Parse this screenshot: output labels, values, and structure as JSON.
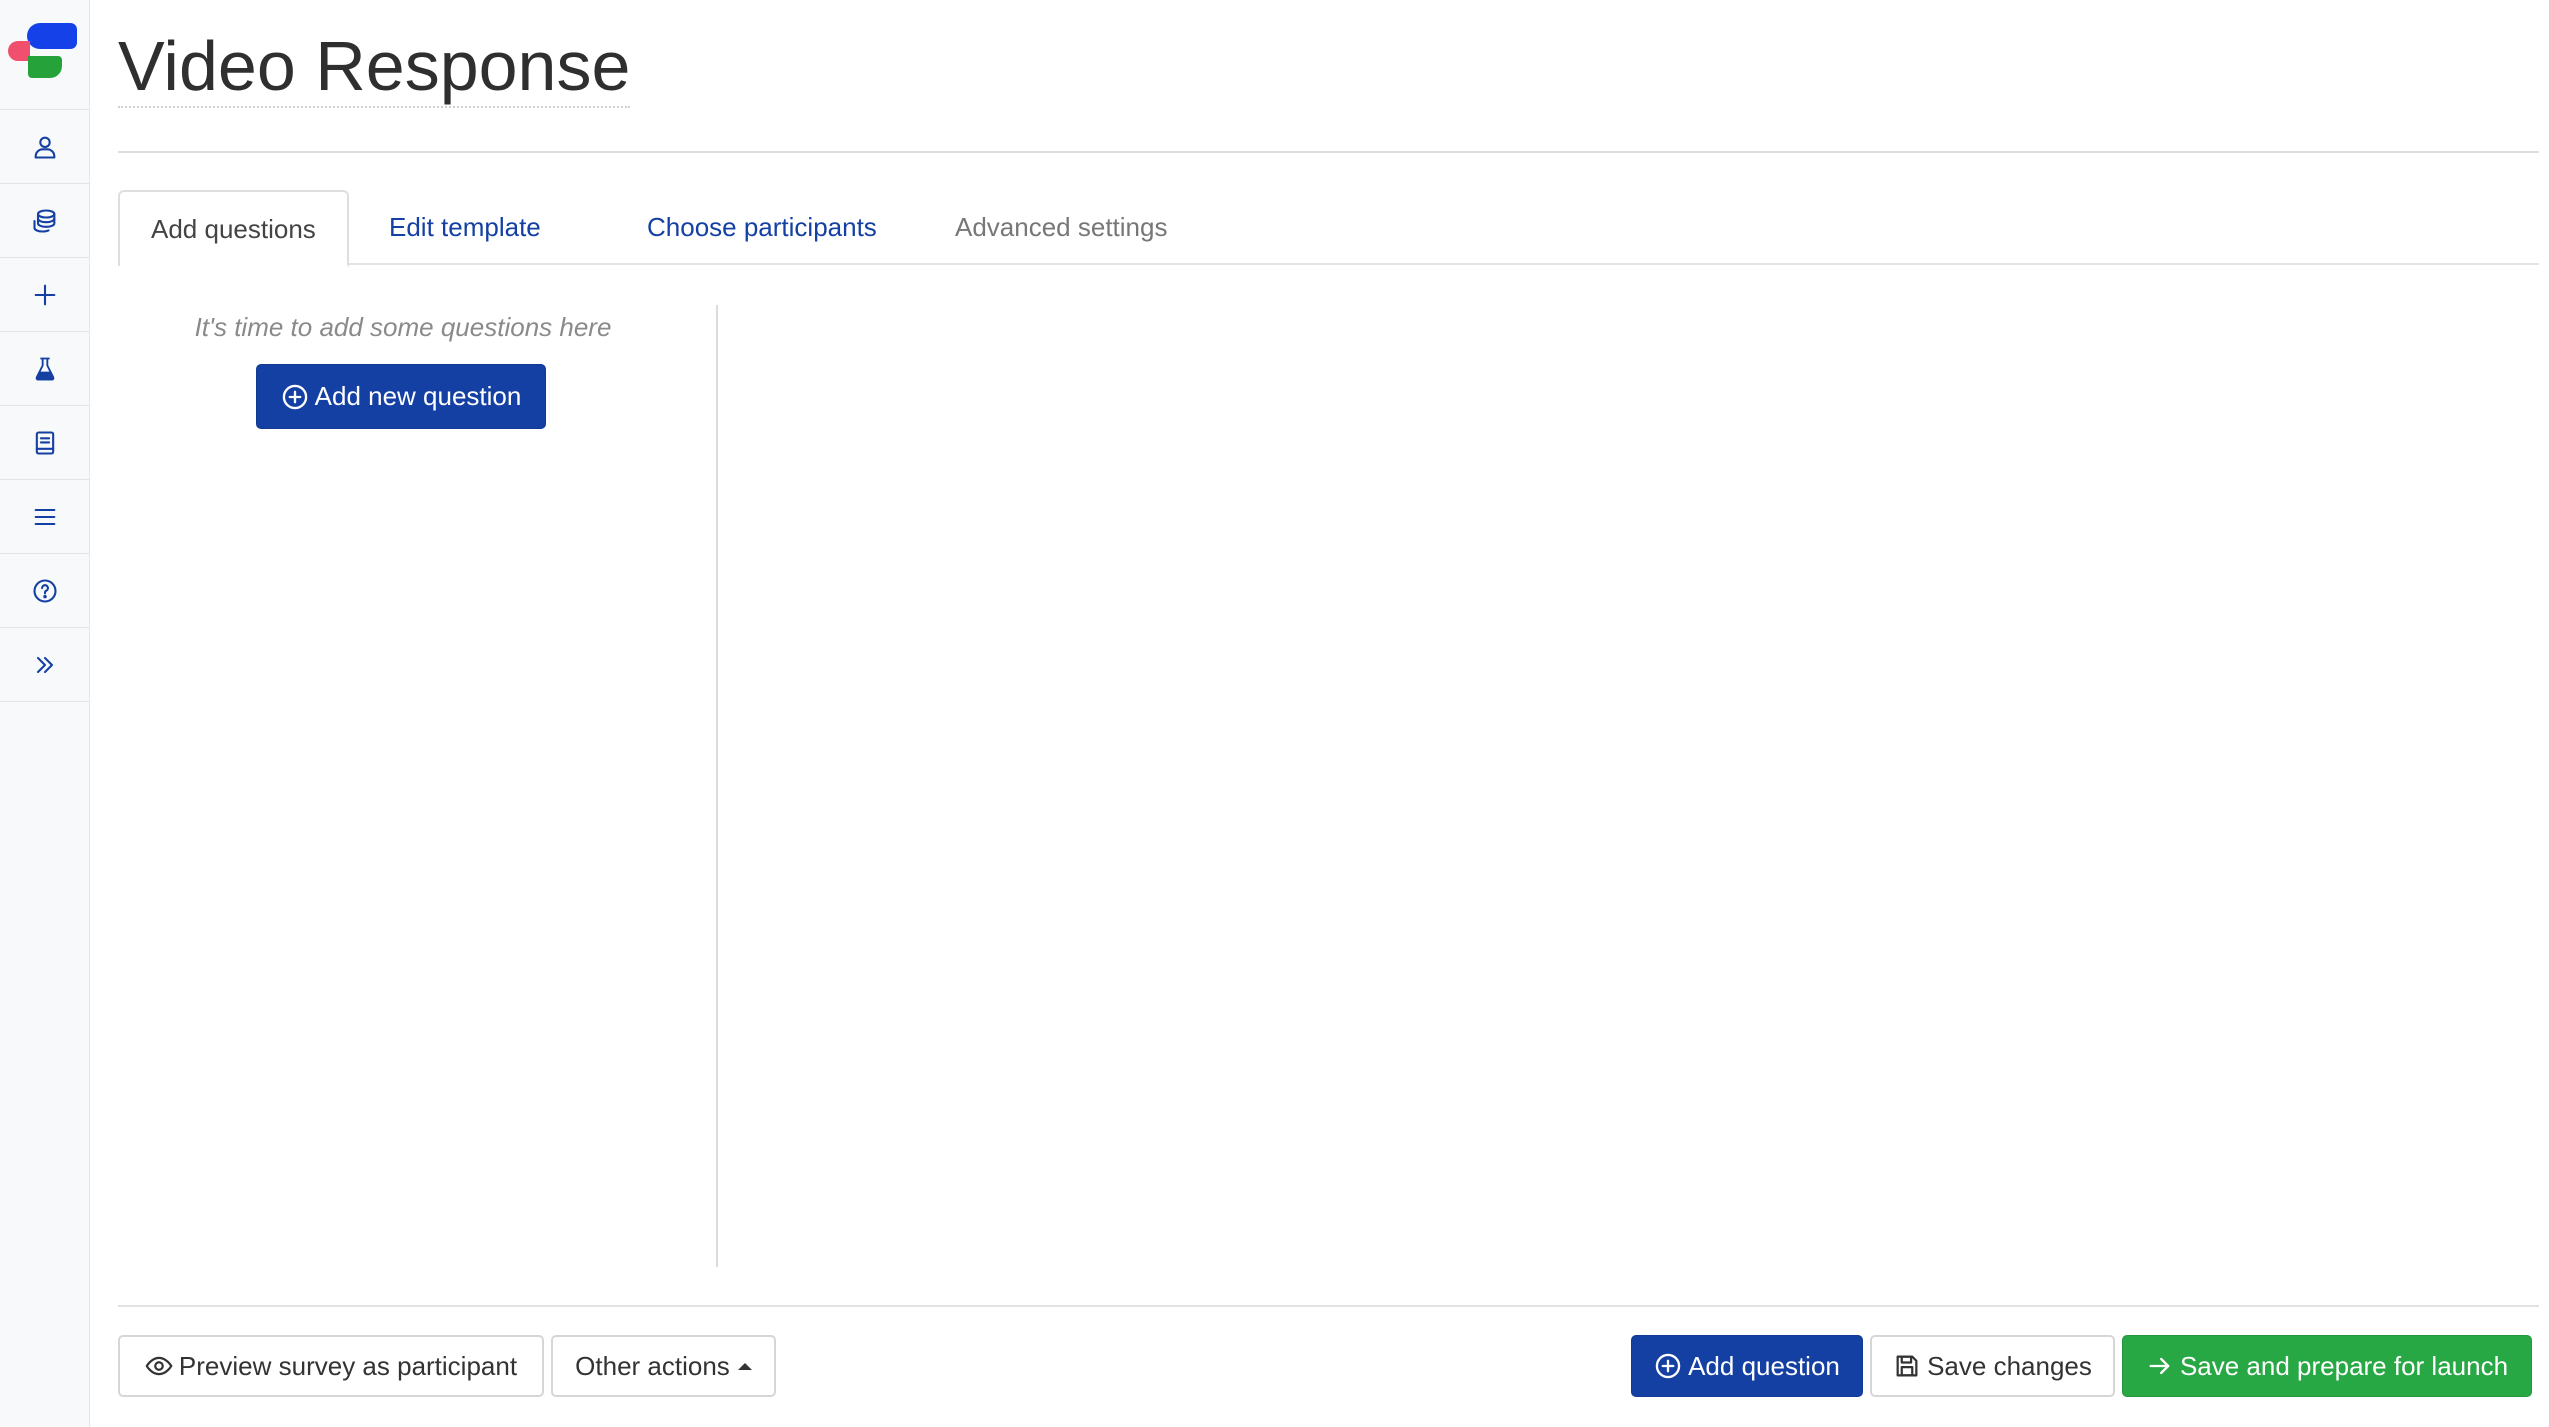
{
  "page": {
    "title": "Video Response"
  },
  "sidebar": {
    "logo": "app-logo",
    "items": [
      {
        "icon": "user-icon",
        "label": ""
      },
      {
        "icon": "database-icon",
        "label": ""
      },
      {
        "icon": "plus-icon",
        "label": ""
      },
      {
        "icon": "flask-icon",
        "label": ""
      },
      {
        "icon": "book-icon",
        "label": ""
      },
      {
        "icon": "menu-icon",
        "label": ""
      },
      {
        "icon": "help-icon",
        "label": ""
      },
      {
        "icon": "chevrons-right-icon",
        "label": ""
      }
    ]
  },
  "tabs": [
    {
      "label": "Add questions",
      "state": "active"
    },
    {
      "label": "Edit template",
      "state": "link"
    },
    {
      "label": "Choose participants",
      "state": "link"
    },
    {
      "label": "Advanced settings",
      "state": "muted"
    }
  ],
  "questions_panel": {
    "empty_hint": "It's time to add some questions here",
    "add_new_label": "Add new question"
  },
  "footer": {
    "preview_label": "Preview survey as participant",
    "other_actions_label": "Other actions",
    "add_question_label": "Add question",
    "save_label": "Save changes",
    "save_launch_label": "Save and prepare for launch"
  },
  "colors": {
    "primary": "#1540a3",
    "success": "#28a745",
    "logo_blue": "#1542e8",
    "logo_red": "#f0506e",
    "logo_green": "#25a33a"
  }
}
